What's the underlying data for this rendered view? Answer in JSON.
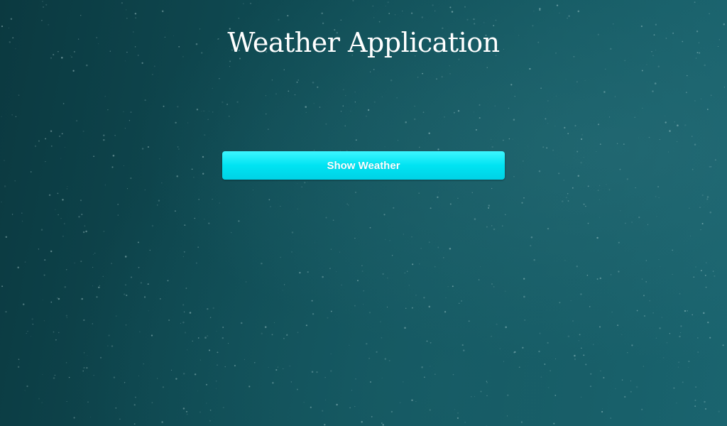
{
  "app": {
    "title": "Weather Application"
  },
  "actions": {
    "show_weather_label": "Show Weather"
  },
  "colors": {
    "background": "#0f4a52",
    "button": "#00e3f2",
    "text": "#ffffff"
  }
}
